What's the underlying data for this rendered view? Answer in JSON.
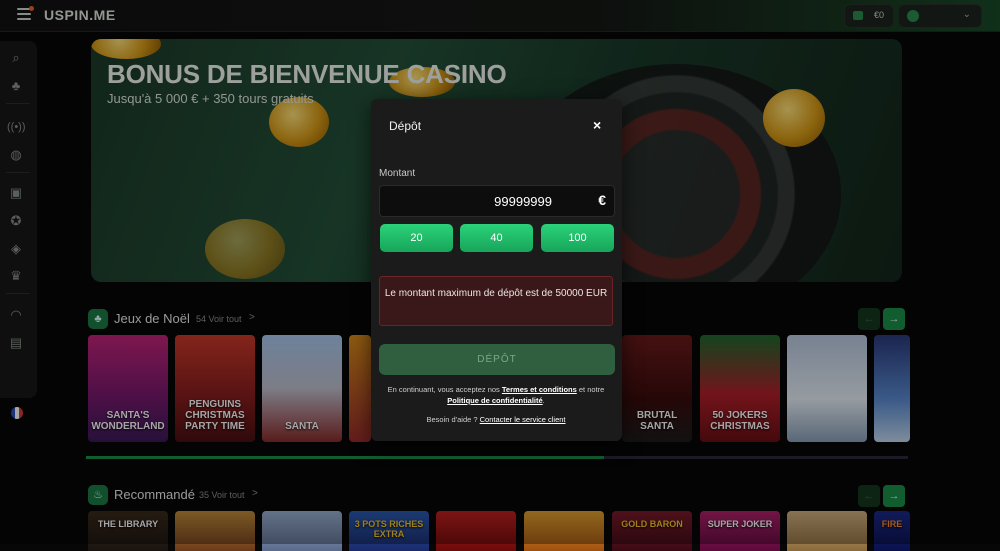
{
  "topbar": {
    "logo": "USPIN.ME",
    "balance": "€0"
  },
  "banner": {
    "title": "BONUS DE BIENVENUE CASINO",
    "subtitle": "Jusqu'à 5 000 € + 350 tours gratuits"
  },
  "sections": {
    "christmas": {
      "title": "Jeux de Noël",
      "count": "54 Voir tout",
      "chevron": ">"
    },
    "recommended": {
      "title": "Recommandé",
      "count": "35 Voir tout",
      "chevron": ">"
    }
  },
  "christmas_games": [
    "SANTA'S WONDERLAND",
    "PENGUINS CHRISTMAS PARTY TIME",
    "SANTA",
    "",
    "",
    "",
    "BRUTAL SANTA",
    "50 JOKERS CHRISTMAS",
    "",
    ""
  ],
  "recommended_games": [
    "THE LIBRARY",
    "",
    "",
    "3 POTS RICHES EXTRA",
    "",
    "",
    "GOLD BARON",
    "SUPER JOKER",
    "",
    "FIRE"
  ],
  "carousel_progress": 0.63,
  "modal": {
    "title": "Dépôt",
    "close_icon": "×",
    "amount_label": "Montant",
    "amount_value": "99999999",
    "currency_symbol": "€",
    "presets": [
      "20",
      "40",
      "100"
    ],
    "error_message": "Le montant maximum de dépôt est de 50000 EUR",
    "submit_label": "DÉPÔT",
    "terms_prefix": "En continuant, vous acceptez nos",
    "terms_link": "Termes et conditions",
    "terms_and": "et notre",
    "privacy_link": "Politique de confidentialité",
    "terms_suffix": ".",
    "help_prefix": "Besoin d'aide ?",
    "help_link": "Contacter le service client"
  },
  "colors": {
    "accent": "#1d8f4a",
    "preset_button": "#2bd27a",
    "error_bg": "#3a1718"
  },
  "icons": {
    "sidebar": [
      "search-icon",
      "club-icon",
      "live-icon",
      "sports-icon",
      "gift-icon",
      "vip-icon",
      "moneybag-icon",
      "crown-icon",
      "support-icon",
      "cashier-icon",
      "flag-fr-icon"
    ]
  }
}
